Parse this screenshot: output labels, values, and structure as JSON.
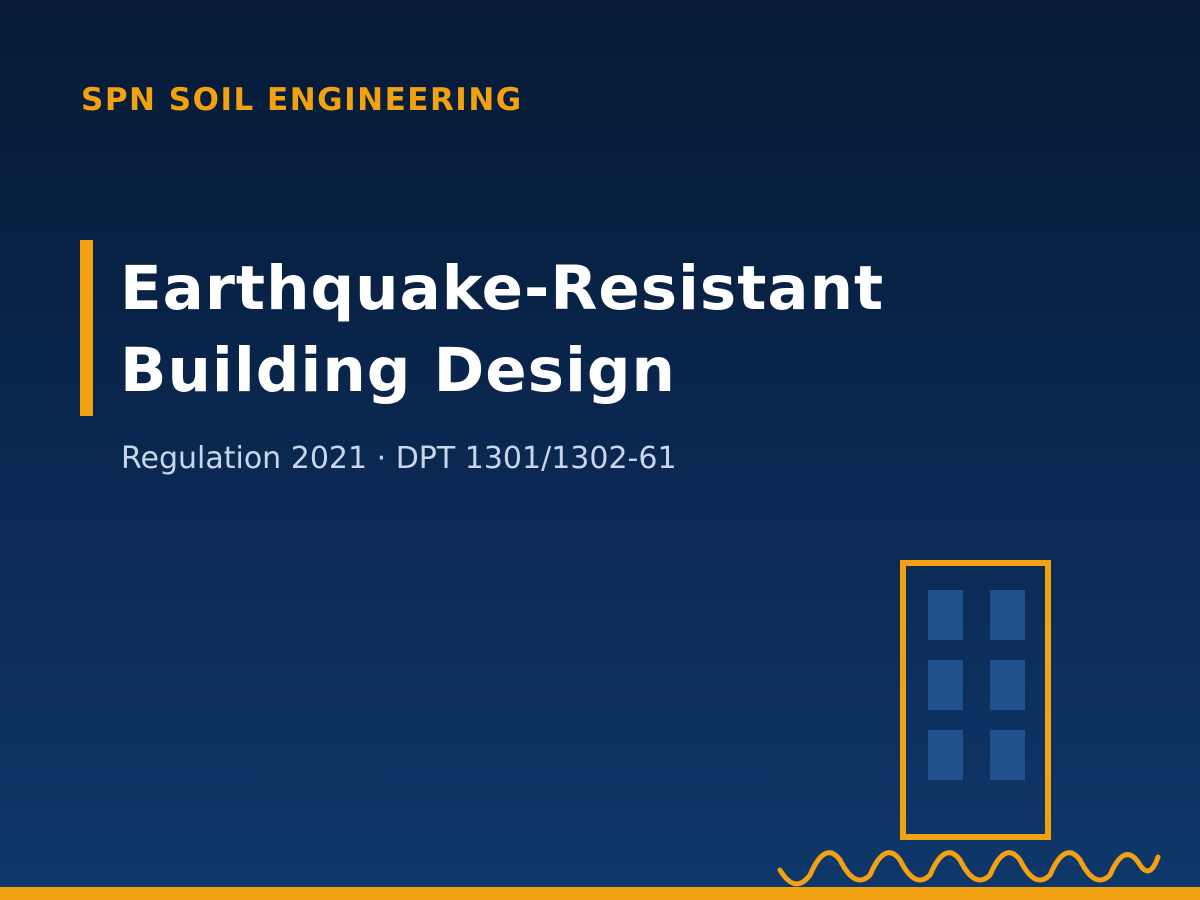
{
  "brand": {
    "name": "SPN SOIL ENGINEERING"
  },
  "title": {
    "line1": "Earthquake-Resistant",
    "line2": "Building Design"
  },
  "subtitle": "Regulation 2021 · DPT 1301/1302-61",
  "colors": {
    "accent": "#f2a111",
    "background_top": "#061a36",
    "background_bottom": "#0f386b",
    "title_text": "#ffffff",
    "subtitle_text": "#c9d6ea",
    "window_fill": "#21508f"
  },
  "illustration": {
    "building_icon": "building-icon",
    "seismic_wave_icon": "seismic-wave-icon"
  }
}
